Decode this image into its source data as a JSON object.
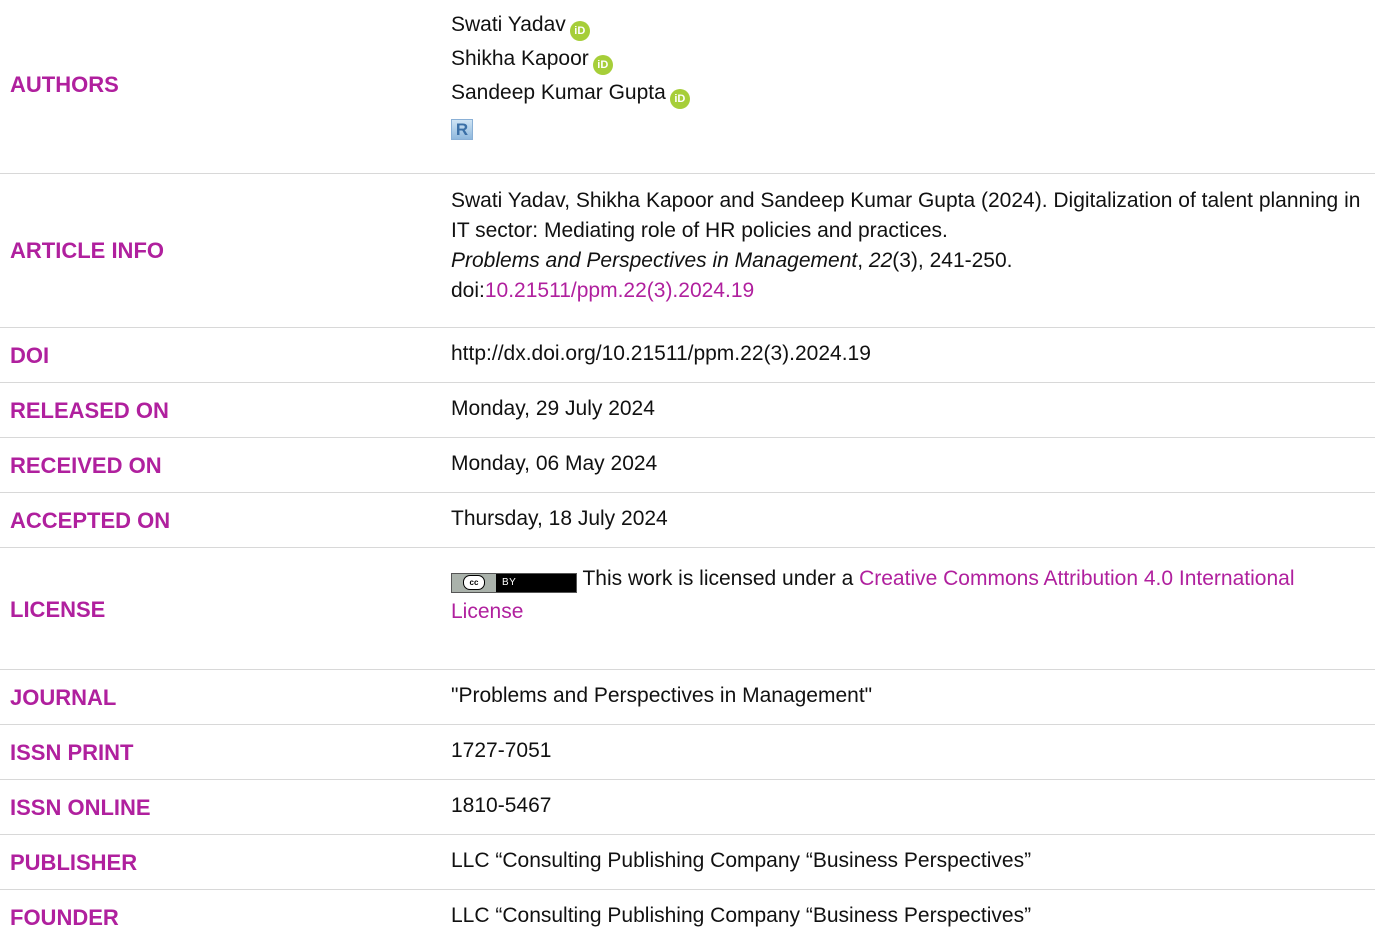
{
  "authors": {
    "label": "AUTHORS",
    "names": [
      "Swati Yadav",
      "Shikha Kapoor",
      "Sandeep Kumar Gupta"
    ],
    "orcid_icon_text": "iD",
    "researcherid_icon_text": "R"
  },
  "article_info": {
    "label": "ARTICLE INFO",
    "citation_text": "Swati Yadav, Shikha Kapoor and Sandeep Kumar Gupta (2024). Digitalization of talent planning in IT sector: Mediating role of HR policies and practices.",
    "journal_italic": "Problems and Perspectives in Management",
    "comma": ", ",
    "volume_italic": "22",
    "issue_pages": "(3), 241-250.",
    "doi_prefix": "doi:",
    "doi_link": "10.21511/ppm.22(3).2024.19"
  },
  "doi": {
    "label": "DOI",
    "value": "http://dx.doi.org/10.21511/ppm.22(3).2024.19"
  },
  "released": {
    "label": "RELEASED ON",
    "value": "Monday, 29 July 2024"
  },
  "received": {
    "label": "RECEIVED ON",
    "value": "Monday, 06 May 2024"
  },
  "accepted": {
    "label": "ACCEPTED ON",
    "value": "Thursday, 18 July 2024"
  },
  "license": {
    "label": "LICENSE",
    "badge_cc": "cc",
    "badge_by": "BY",
    "text_prefix": "This work is licensed under a ",
    "link_text": "Creative Commons Attribution 4.0 International License"
  },
  "journal": {
    "label": "JOURNAL",
    "value": "\"Problems and Perspectives in Management\""
  },
  "issn_print": {
    "label": "ISSN PRINT",
    "value": "1727-7051"
  },
  "issn_online": {
    "label": "ISSN ONLINE",
    "value": "1810-5467"
  },
  "publisher": {
    "label": "PUBLISHER",
    "value": "LLC “Consulting Publishing Company “Business Perspectives”"
  },
  "founder": {
    "label": "FOUNDER",
    "value": "LLC “Consulting Publishing Company “Business Perspectives”"
  },
  "colors": {
    "label": "#b0209e",
    "link": "#b0209e",
    "orcid": "#a6ce39",
    "divider": "#d8d8d8"
  }
}
